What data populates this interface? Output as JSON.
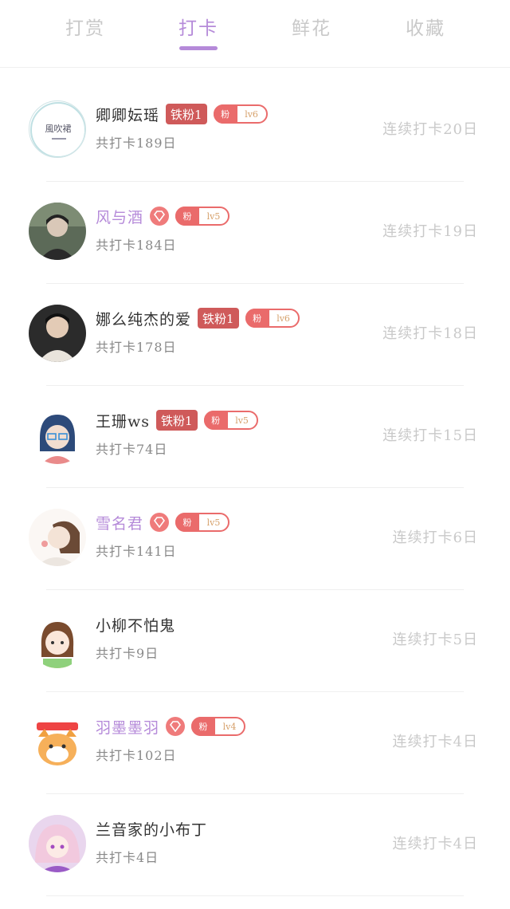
{
  "tabs": [
    {
      "label": "打赏",
      "active": false
    },
    {
      "label": "打卡",
      "active": true
    },
    {
      "label": "鲜花",
      "active": false
    },
    {
      "label": "收藏",
      "active": false
    }
  ],
  "colors": {
    "accent": "#b58ad9",
    "iron_badge": "#cf5a5a",
    "fan_badge": "#ea6b6b",
    "muted": "#c9c9c9"
  },
  "rows": [
    {
      "name": "卿卿妘瑶",
      "name_color": "default",
      "badge": "铁粉1",
      "fan_label": "粉",
      "fan_level": "lv6",
      "total": "共打卡189日",
      "streak": "连续打卡20日",
      "avatar_text": "風吹裙",
      "avatar_note": "logo-avatar"
    },
    {
      "name": "风与酒",
      "name_color": "purple",
      "badge_icon": "diamond-icon",
      "fan_label": "粉",
      "fan_level": "lv5",
      "total": "共打卡184日",
      "streak": "连续打卡19日"
    },
    {
      "name": "娜么纯杰的爱",
      "name_color": "default",
      "badge": "铁粉1",
      "fan_label": "粉",
      "fan_level": "lv6",
      "total": "共打卡178日",
      "streak": "连续打卡18日"
    },
    {
      "name": "王珊ws",
      "name_color": "default",
      "badge": "铁粉1",
      "fan_label": "粉",
      "fan_level": "lv5",
      "total": "共打卡74日",
      "streak": "连续打卡15日"
    },
    {
      "name": "雪名君",
      "name_color": "purple",
      "badge_icon": "diamond-icon",
      "fan_label": "粉",
      "fan_level": "lv5",
      "total": "共打卡141日",
      "streak": "连续打卡6日"
    },
    {
      "name": "小柳不怕鬼",
      "name_color": "default",
      "total": "共打卡9日",
      "streak": "连续打卡5日"
    },
    {
      "name": "羽墨墨羽",
      "name_color": "purple",
      "badge_icon": "diamond-icon",
      "fan_label": "粉",
      "fan_level": "lv4",
      "total": "共打卡102日",
      "streak": "连续打卡4日"
    },
    {
      "name": "兰音家的小布丁",
      "name_color": "default",
      "total": "共打卡4日",
      "streak": "连续打卡4日"
    }
  ]
}
